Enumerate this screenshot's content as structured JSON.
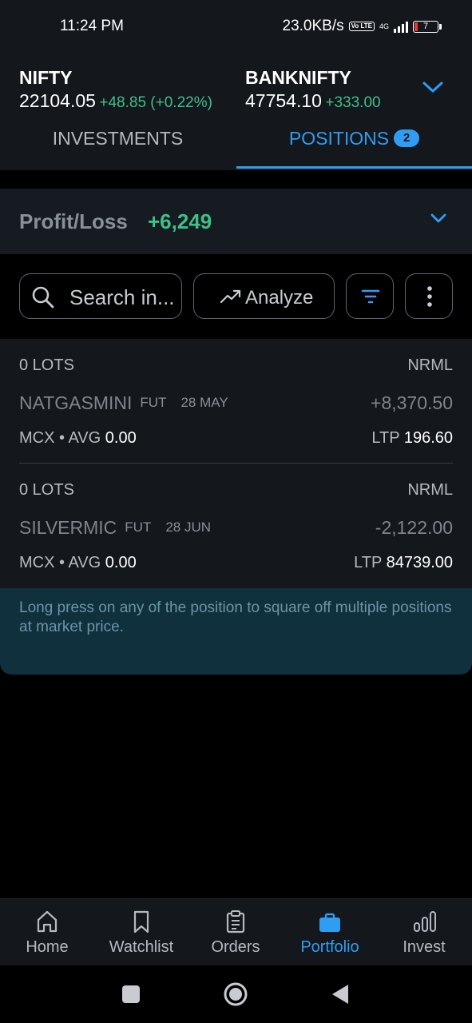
{
  "status_bar": {
    "time": "11:24 PM",
    "net_speed": "23.0KB/s",
    "volte": "Vo LTE",
    "network": "4G",
    "battery": "7",
    "battery_low_color": "#e53935"
  },
  "indices": [
    {
      "name": "NIFTY",
      "value": "22104.05",
      "change": "+48.85 (+0.22%)"
    },
    {
      "name": "BANKNIFTY",
      "value": "47754.10",
      "change": "+333.00"
    }
  ],
  "tabs": {
    "investments": "INVESTMENTS",
    "positions": "POSITIONS",
    "positions_count": "2",
    "active": "positions"
  },
  "profit_loss": {
    "label": "Profit/Loss",
    "value": "+6,249"
  },
  "toolbar": {
    "search_placeholder": "Search in...",
    "analyze_label": "Analyze"
  },
  "positions": [
    {
      "lots": "0 LOTS",
      "product": "NRML",
      "symbol": "NATGASMINI",
      "instrument": "FUT",
      "expiry": "28 MAY",
      "pnl": "+8,370.50",
      "exchange_avg_label": "MCX • AVG",
      "avg": "0.00",
      "ltp_label": "LTP",
      "ltp": "196.60"
    },
    {
      "lots": "0 LOTS",
      "product": "NRML",
      "symbol": "SILVERMIC",
      "instrument": "FUT",
      "expiry": "28 JUN",
      "pnl": "-2,122.00",
      "exchange_avg_label": "MCX • AVG",
      "avg": "0.00",
      "ltp_label": "LTP",
      "ltp": "84739.00"
    }
  ],
  "notice": "Long press on any of the position to square off multiple positions at market price.",
  "bottom_nav": [
    {
      "label": "Home",
      "icon": "home-icon"
    },
    {
      "label": "Watchlist",
      "icon": "bookmark-icon"
    },
    {
      "label": "Orders",
      "icon": "clipboard-icon"
    },
    {
      "label": "Portfolio",
      "icon": "briefcase-icon",
      "active": true
    },
    {
      "label": "Invest",
      "icon": "bar-chart-icon"
    }
  ],
  "colors": {
    "accent": "#2f9df2",
    "positive": "#3ec08a",
    "background": "#14171c"
  }
}
